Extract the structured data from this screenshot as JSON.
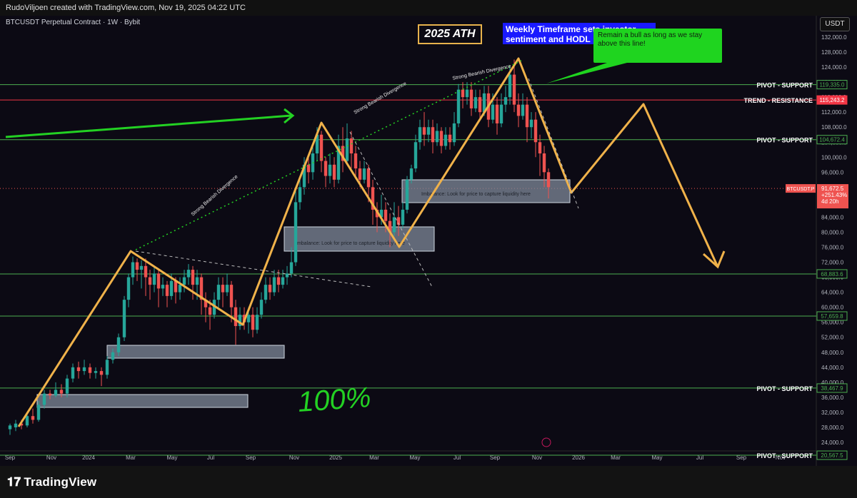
{
  "header": {
    "credit": "RudoViljoen created with TradingView.com, Nov 19, 2025 04:22 UTC"
  },
  "chart_data": {
    "type": "candlestick",
    "symbol": "BTCUSDT Perpetual Contract · 1W · Bybit",
    "currency_button": "USDT",
    "y_ticks": [
      132000,
      128000,
      124000,
      120000,
      116000,
      112000,
      108000,
      104000,
      100000,
      96000,
      92000,
      88000,
      84000,
      80000,
      76000,
      72000,
      68000,
      64000,
      60000,
      56000,
      52000,
      48000,
      44000,
      40000,
      36000,
      32000,
      28000,
      24000
    ],
    "y_tick_labels": [
      "132,000.0",
      "128,000.0",
      "124,000.0",
      "120,000.0",
      "116,000.0",
      "112,000.0",
      "108,000.0",
      "104,000.0",
      "100,000.0",
      "96,000.0",
      "92,000.0",
      "88,000.0",
      "84,000.0",
      "80,000.0",
      "76,000.0",
      "72,000.0",
      "68,000.0",
      "64,000.0",
      "60,000.0",
      "56,000.0",
      "52,000.0",
      "48,000.0",
      "44,000.0",
      "40,000.0",
      "36,000.0",
      "32,000.0",
      "28,000.0",
      "24,000.0"
    ],
    "x_labels": [
      "Sep",
      "Nov",
      "2024",
      "Mar",
      "May",
      "Jul",
      "Sep",
      "Nov",
      "2025",
      "Mar",
      "May",
      "Jul",
      "Sep",
      "Nov",
      "2026",
      "Mar",
      "May",
      "Jul",
      "Sep",
      "Nov"
    ],
    "levels": [
      {
        "label": "PIVOT - SUPPORT",
        "price": 119335,
        "value_label": "119,335.0",
        "color": "#4caf50"
      },
      {
        "label": "TREND - RESISTANCE",
        "price": 115243,
        "value_label": "115,243.2",
        "color": "#f23645"
      },
      {
        "label": "PIVOT - SUPPORT",
        "price": 104672,
        "value_label": "104,672.4",
        "color": "#4caf50"
      },
      {
        "label": "",
        "price": 68883,
        "value_label": "68,883.6",
        "color": "#4caf50"
      },
      {
        "label": "",
        "price": 57659,
        "value_label": "57,659.8",
        "color": "#4caf50"
      },
      {
        "label": "PIVOT - SUPPORT",
        "price": 38467,
        "value_label": "38,467.9",
        "color": "#4caf50"
      },
      {
        "label": "PIVOT - SUPPORT",
        "price": 20567,
        "value_label": "20,567.5",
        "color": "#4caf50"
      }
    ],
    "last_price": {
      "label": "BTCUSDT.P",
      "value": "91,672.5",
      "change": "+251.43%",
      "countdown": "4d 20h"
    },
    "annotations": {
      "ath": "2025 ATH",
      "weekly": "Weekly Timeframe sets investor sentiment and HODL",
      "bull_note": "Remain a bull as long as we stay above this line!",
      "divergence1": "Strong Bearish Divergence",
      "divergence2": "Strong Bearish Divergence",
      "divergence3": "Strong Bearish Divergence",
      "imbalance1": "Imbalance: Look for price to capture liquidity here",
      "imbalance2": "Imbalance: Look for price to capture liquidity here",
      "handwriting": "100%"
    }
  },
  "footer": {
    "brand": "TradingView"
  },
  "colors": {
    "up": "#26a69a",
    "down": "#ef5350",
    "orange": "#f0b24a",
    "green": "#23d123"
  }
}
